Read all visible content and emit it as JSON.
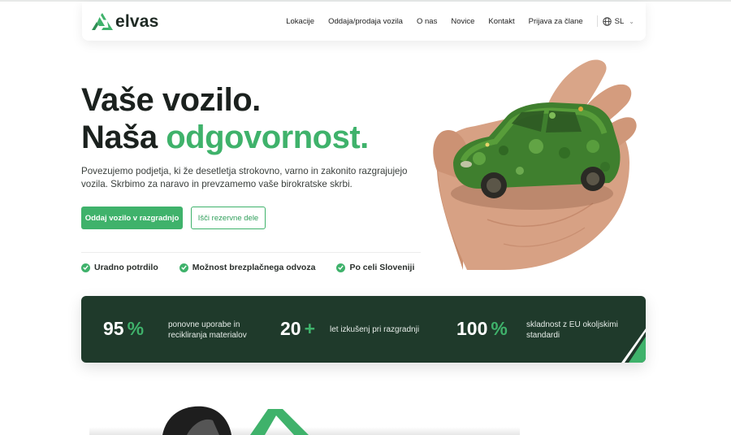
{
  "brand": {
    "name": "elvas",
    "logo_icon": "elvas-recycle-logo-icon"
  },
  "nav": {
    "items": [
      {
        "label": "Lokacije"
      },
      {
        "label": "Oddaja/prodaja vozila"
      },
      {
        "label": "O nas"
      },
      {
        "label": "Novice"
      },
      {
        "label": "Kontakt"
      },
      {
        "label": "Prijava za člane"
      }
    ],
    "language": {
      "code": "SL",
      "icon": "globe-icon"
    }
  },
  "hero": {
    "title_line1": "Vaše vozilo.",
    "title_line2_prefix": "Naša ",
    "title_line2_accent": "odgovornost.",
    "lead": "Povezujemo podjetja, ki že desetletja strokovno, varno in zakonito razgrajujejo vozila. Skrbimo za naravo in prevzamemo vaše birokratske skrbi.",
    "primary_button": "Oddaj vozilo v razgradnjo",
    "secondary_button": "Išči rezervne dele",
    "features": [
      {
        "label": "Uradno potrdilo"
      },
      {
        "label": "Možnost brezplačnega odvoza"
      },
      {
        "label": "Po celi Sloveniji"
      }
    ],
    "image": "hand-holding-moss-covered-car"
  },
  "stats": [
    {
      "value": "95",
      "unit": "%",
      "text": "ponovne uporabe in recikliranja materialov"
    },
    {
      "value": "20",
      "unit": "+",
      "text": "let izkušenj pri razgradnji"
    },
    {
      "value": "100",
      "unit": "%",
      "text": "skladnost z EU okoljskimi standardi"
    }
  ],
  "colors": {
    "accent": "#3fb26b",
    "dark_green": "#1f3a2b",
    "text_dark": "#1b211e"
  }
}
